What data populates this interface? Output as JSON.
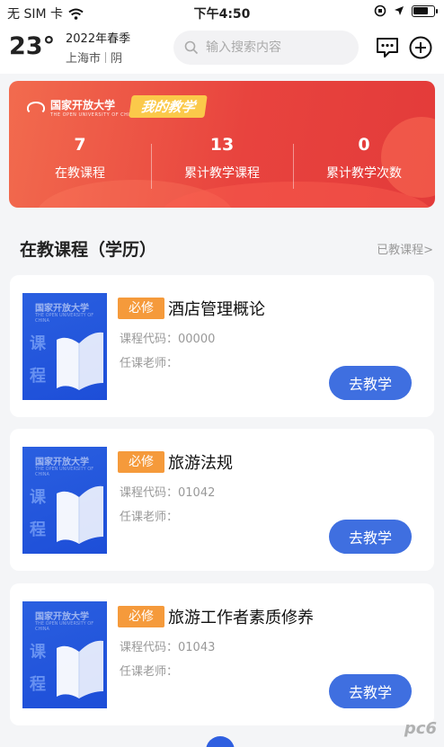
{
  "status_bar": {
    "carrier": "无 SIM 卡",
    "time": "下午4:50",
    "battery_level": 0.75
  },
  "header": {
    "temperature": "23°",
    "season": "2022年春季",
    "city": "上海市",
    "weather": "阴",
    "search_placeholder": "输入搜索内容",
    "icons": [
      "message-icon",
      "add-icon"
    ]
  },
  "banner": {
    "university": "国家开放大学",
    "university_en": "THE OPEN UNIVERSITY OF CHINA",
    "tag": "我的教学",
    "stats": [
      {
        "value": "7",
        "label": "在教课程"
      },
      {
        "value": "13",
        "label": "累计教学课程"
      },
      {
        "value": "0",
        "label": "累计教学次数"
      }
    ]
  },
  "section": {
    "title": "在教课程（学历）",
    "more": "已教课程>"
  },
  "cover": {
    "logo": "国家开放大学",
    "sub": "THE OPEN UNIVERSITY OF CHINA",
    "chars": [
      "课",
      "程"
    ]
  },
  "courses": [
    {
      "badge": "必修",
      "name": "酒店管理概论",
      "code_label": "课程代码：00000",
      "teacher_label": "任课老师：",
      "button": "去教学"
    },
    {
      "badge": "必修",
      "name": "旅游法规",
      "code_label": "课程代码：01042",
      "teacher_label": "任课老师：",
      "button": "去教学"
    },
    {
      "badge": "必修",
      "name": "旅游工作者素质修养",
      "code_label": "课程代码：01043",
      "teacher_label": "任课老师：",
      "button": "去教学"
    }
  ],
  "watermark": "pc6",
  "colors": {
    "banner": "#e8433e",
    "tag": "#fbc94a",
    "badge": "#f59a3b",
    "button": "#3f6fe0",
    "cover": "#1d4ed8"
  }
}
